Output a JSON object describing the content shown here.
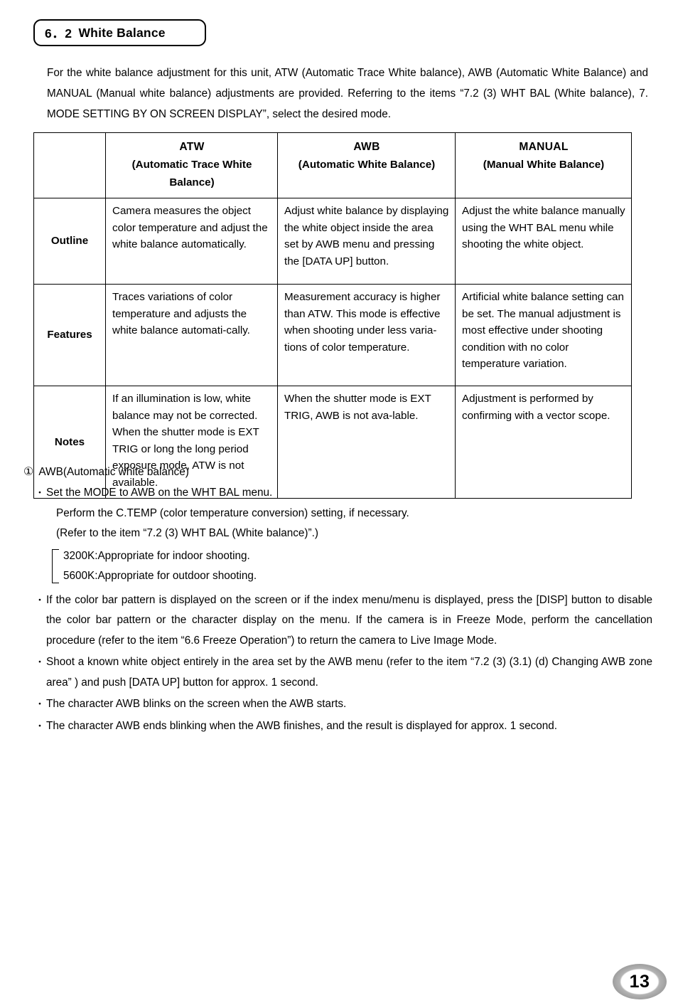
{
  "section": {
    "number": "6．2",
    "title": "White Balance"
  },
  "intro": {
    "paragraph": "For the white balance adjustment for this unit, ATW (Automatic Trace White balance), AWB (Automatic White Balance) and MANUAL (Manual white balance) adjustments are provided. Referring to the items “7.2 (3) WHT BAL (White balance), 7. MODE SETTING BY ON SCREEN DISPLAY”, select the desired mode."
  },
  "table": {
    "corner_label": "",
    "columns": [
      {
        "main": "ATW",
        "sub": "(Automatic Trace White Balance)"
      },
      {
        "main": "AWB",
        "sub": "(Automatic White Balance)"
      },
      {
        "main": "MANUAL",
        "sub": "(Manual White Balance)"
      }
    ],
    "rows": [
      {
        "label": "Outline",
        "cells": [
          "Camera measures the object color temperature and adjust the white balance automatically.",
          "Adjust white balance by displaying the white object inside the area set by AWB menu and pressing the [DATA UP] button.",
          "Adjust the white balance manually using the WHT BAL menu while shooting the white object."
        ]
      },
      {
        "label": "Features",
        "cells": [
          "Traces variations of color temperature and adjusts the white balance automati-cally.",
          "Measurement accuracy is higher than ATW. This mode is effective when shooting under less varia-tions of color temperature.",
          "Artificial white balance setting can be set. The manual adjustment is most effective under shooting condition with no color temperature variation."
        ]
      },
      {
        "label": "Notes",
        "cells": [
          "If an illumination is low, white balance may not be corrected. When the shutter mode is EXT TRIG or long the long period exposure mode, ATW is not available.",
          "When the shutter mode is EXT TRIG, AWB is not ava-lable.",
          "Adjustment is performed by confirming with a vector scope."
        ]
      }
    ]
  },
  "awb_section": {
    "marker": "①",
    "heading": "AWB(Automatic white balance)",
    "bullet_glyph": "・",
    "item1": "Set the MODE to AWB on the WHT BAL menu.",
    "item1_line2": "Perform the C.TEMP (color temperature conversion) setting, if necessary.",
    "item1_line3": "(Refer to the item “7.2 (3) WHT BAL (White balance)”.)",
    "temperatures": [
      {
        "value": "3200K",
        "separator": ":",
        "description": "Appropriate for indoor shooting."
      },
      {
        "value": "5600K",
        "separator": ":",
        "description": "Appropriate for outdoor shooting."
      }
    ],
    "item2": "If the color bar pattern is displayed on the screen or if the index menu/menu is displayed, press the [DISP] button to disable the color bar pattern or the character display on the menu. If the camera is in Freeze Mode, perform the cancellation procedure (refer to the item “6.6 Freeze Operation”) to return the camera to Live Image Mode.",
    "item3": "Shoot a known white object entirely in the area set by the AWB menu (refer to the item “7.2 (3) (3.1) (d) Changing AWB zone area” ) and push [DATA UP] button for approx. 1 second.",
    "item4": "The character AWB blinks on the screen when the AWB starts.",
    "item5": "The character AWB ends blinking when the AWB finishes, and the result is displayed for approx. 1 second."
  },
  "footer": {
    "page_number": "13"
  }
}
